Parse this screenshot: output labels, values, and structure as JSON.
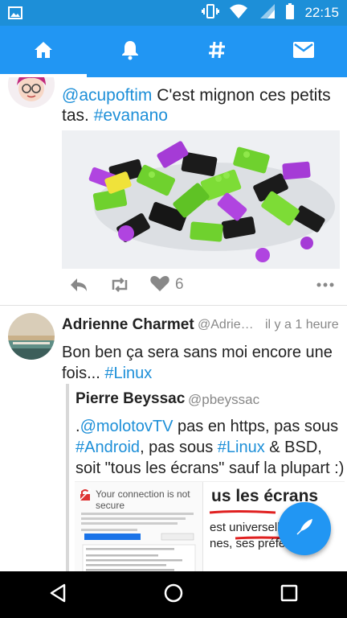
{
  "status_bar": {
    "time": "22:15",
    "icons": [
      "image-icon",
      "vibrate-icon",
      "wifi-icon",
      "signal-icon",
      "battery-icon"
    ]
  },
  "nav": {
    "tabs": [
      {
        "name": "home",
        "icon": "home-icon",
        "active": true
      },
      {
        "name": "notifications",
        "icon": "bell-icon",
        "active": false
      },
      {
        "name": "trends",
        "icon": "hashtag-icon",
        "active": false
      },
      {
        "name": "messages",
        "icon": "mail-icon",
        "active": false
      }
    ]
  },
  "tweet1": {
    "mention": "@acupoftim",
    "text": " C'est mignon ces petits tas. ",
    "hashtag": "#evanano",
    "like_count": "6",
    "media": "photo-of-colorful-toy-bricks"
  },
  "tweet2": {
    "name": "Adrienne Charmet",
    "handle": "@Adrien…",
    "time": "il y a 1 heure",
    "text": "Bon ben ça sera sans moi encore une fois... ",
    "hashtag": "#Linux",
    "quote": {
      "name": "Pierre Beyssac",
      "handle": "@pbeyssac",
      "text_prefix": ".",
      "mention": "@molotovTV",
      "text_1": " pas en https, pas sous ",
      "hashtag_1": "#Android",
      "text_2": ", pas sous ",
      "hashtag_2": "#Linux",
      "text_3": " & BSD, soit \"tous les écrans\" sauf la plupart :)",
      "screenshot": {
        "left_title": "Your connection is not secure",
        "right_heading": "us les écrans",
        "right_line1": "est universelle",
        "right_line2": "nes, ses préfére"
      }
    }
  },
  "colors": {
    "accent": "#2196f3",
    "status_bar": "#1d8fd8",
    "link": "#1d8fd8",
    "muted": "#888888"
  }
}
